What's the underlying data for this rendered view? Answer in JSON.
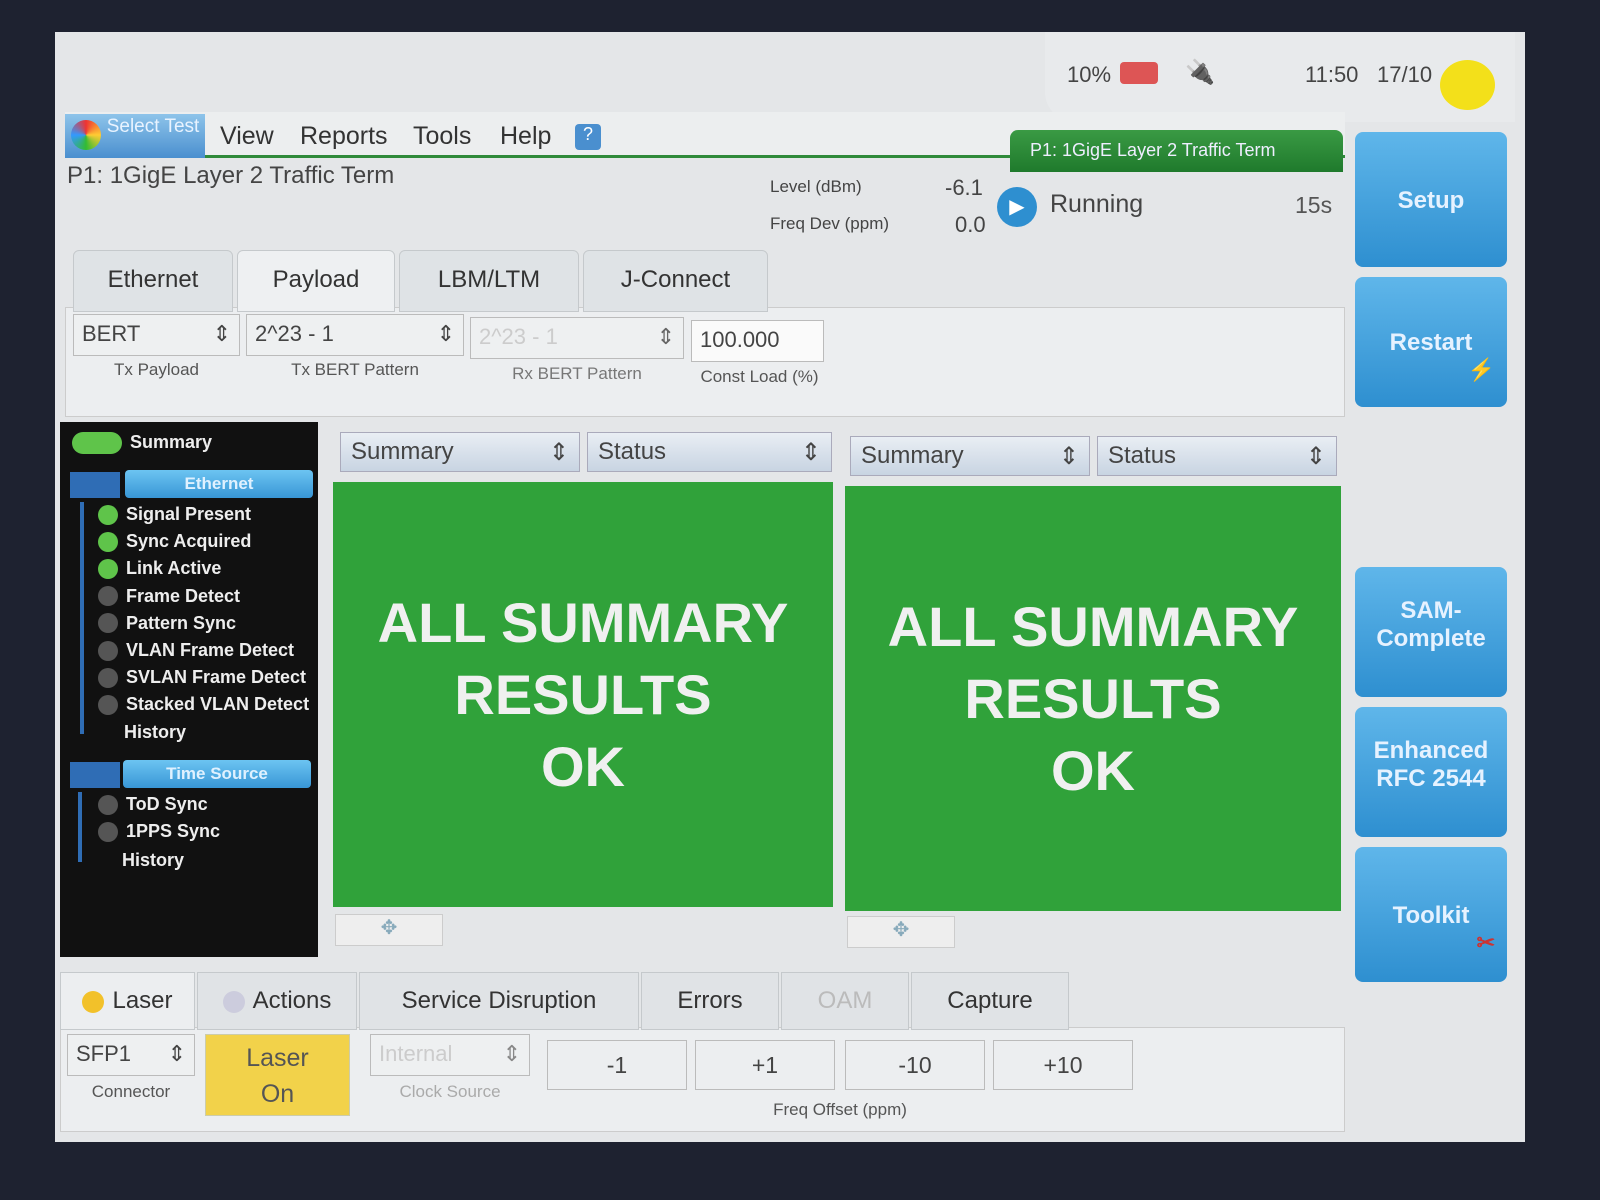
{
  "status_bar": {
    "battery": "10%",
    "time": "11:50",
    "date": "17/10"
  },
  "menu": {
    "select_test": "Select Test",
    "items": [
      "View",
      "Reports",
      "Tools",
      "Help"
    ]
  },
  "test_banner": "P1: 1GigE Layer 2 Traffic Term",
  "test_title": "P1: 1GigE Layer 2 Traffic Term",
  "measurements": {
    "level_label": "Level (dBm)",
    "level_value": "-6.1",
    "freq_label": "Freq Dev (ppm)",
    "freq_value": "0.0",
    "state": "Running",
    "elapsed": "15s"
  },
  "side_buttons": [
    "Setup",
    "Restart",
    "SAM-Complete",
    "Enhanced RFC 2544",
    "Toolkit"
  ],
  "tabs": [
    "Ethernet",
    "Payload",
    "LBM/LTM",
    "J-Connect"
  ],
  "active_tab": "Payload",
  "payload": {
    "tx_payload": {
      "value": "BERT",
      "label": "Tx Payload"
    },
    "tx_bert": {
      "value": "2^23 - 1",
      "label": "Tx BERT Pattern"
    },
    "rx_bert": {
      "value": "2^23 - 1",
      "label": "Rx BERT Pattern"
    },
    "const_load": {
      "value": "100.000",
      "label": "Const Load (%)"
    }
  },
  "tree": {
    "summary": "Summary",
    "ethernet_header": "Ethernet",
    "ethernet_items": [
      {
        "label": "Signal Present",
        "state": "green"
      },
      {
        "label": "Sync Acquired",
        "state": "green"
      },
      {
        "label": "Link Active",
        "state": "green"
      },
      {
        "label": "Frame Detect",
        "state": "gray"
      },
      {
        "label": "Pattern Sync",
        "state": "gray"
      },
      {
        "label": "VLAN Frame Detect",
        "state": "gray"
      },
      {
        "label": "SVLAN Frame Detect",
        "state": "gray"
      },
      {
        "label": "Stacked VLAN Detect",
        "state": "gray"
      }
    ],
    "ethernet_history": "History",
    "time_header": "Time Source",
    "time_items": [
      {
        "label": "ToD Sync",
        "state": "gray"
      },
      {
        "label": "1PPS Sync",
        "state": "gray"
      }
    ],
    "time_history": "History"
  },
  "panes": [
    {
      "group": "Summary",
      "category": "Status",
      "message": [
        "ALL SUMMARY",
        "RESULTS",
        "OK"
      ]
    },
    {
      "group": "Summary",
      "category": "Status",
      "message": [
        "ALL SUMMARY",
        "RESULTS",
        "OK"
      ]
    }
  ],
  "bottom_tabs": [
    "Laser",
    "Actions",
    "Service Disruption",
    "Errors",
    "OAM",
    "Capture"
  ],
  "bottom": {
    "connector": {
      "value": "SFP1",
      "label": "Connector"
    },
    "laser_button": [
      "Laser",
      "On"
    ],
    "clock_source": {
      "value": "Internal",
      "label": "Clock Source"
    },
    "freq_buttons": [
      "-1",
      "+1",
      "-10",
      "+10"
    ],
    "freq_label": "Freq Offset (ppm)"
  },
  "colors": {
    "summary_ok": "#30a23a",
    "accent_blue": "#3896d6",
    "laser_on": "#f2d24a"
  }
}
